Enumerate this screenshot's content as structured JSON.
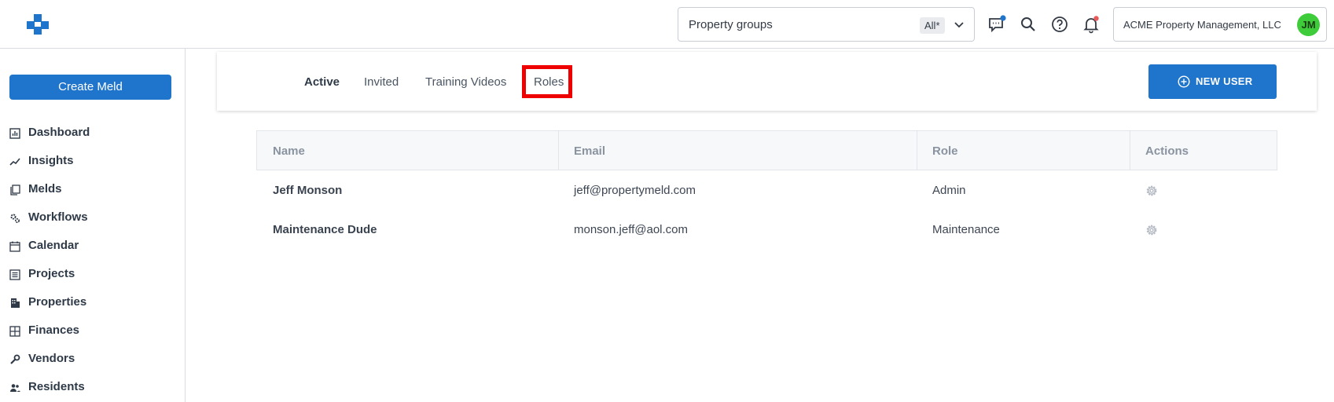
{
  "topbar": {
    "property_groups_label": "Property groups",
    "property_groups_badge": "All*",
    "account_name": "ACME Property Management, LLC",
    "avatar_initials": "JM",
    "icons": [
      "logo-icon",
      "chat-icon",
      "search-icon",
      "help-icon",
      "bell-icon"
    ],
    "colors": {
      "avatar": "#3fcc3a",
      "chat_dot": "#1f74cc",
      "bell_dot": "#e85a5a"
    }
  },
  "sidebar": {
    "create_label": "Create Meld",
    "items": [
      {
        "label": "Dashboard",
        "icon": "dashboard-icon"
      },
      {
        "label": "Insights",
        "icon": "insights-icon"
      },
      {
        "label": "Melds",
        "icon": "melds-icon"
      },
      {
        "label": "Workflows",
        "icon": "workflows-icon"
      },
      {
        "label": "Calendar",
        "icon": "calendar-icon"
      },
      {
        "label": "Projects",
        "icon": "projects-icon"
      },
      {
        "label": "Properties",
        "icon": "properties-icon"
      },
      {
        "label": "Finances",
        "icon": "finances-icon"
      },
      {
        "label": "Vendors",
        "icon": "vendors-icon"
      },
      {
        "label": "Residents",
        "icon": "residents-icon"
      }
    ]
  },
  "tabs": {
    "items": [
      {
        "label": "Active",
        "active": true
      },
      {
        "label": "Invited",
        "active": false
      },
      {
        "label": "Training Videos",
        "active": false
      },
      {
        "label": "Roles",
        "active": false,
        "highlighted": true
      }
    ],
    "new_user_label": "NEW USER",
    "colors": {
      "primary": "#1f74cc",
      "highlight": "#ee0000"
    }
  },
  "table": {
    "headers": [
      "Name",
      "Email",
      "Role",
      "Actions"
    ],
    "rows": [
      {
        "name": "Jeff Monson",
        "email": "jeff@propertymeld.com",
        "role": "Admin",
        "action_icon": "gear-icon"
      },
      {
        "name": "Maintenance Dude",
        "email": "monson.jeff@aol.com",
        "role": "Maintenance",
        "action_icon": "gear-icon"
      }
    ]
  }
}
